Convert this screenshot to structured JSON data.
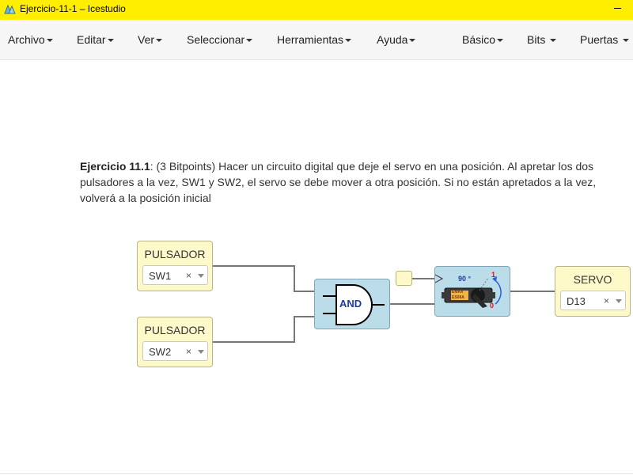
{
  "window": {
    "title": "Ejercicio-11-1 – Icestudio"
  },
  "menubar": {
    "left": [
      {
        "label": "Archivo"
      },
      {
        "label": "Editar"
      },
      {
        "label": "Ver"
      },
      {
        "label": "Seleccionar"
      },
      {
        "label": "Herramientas"
      },
      {
        "label": "Ayuda"
      }
    ],
    "right": [
      {
        "label": "Básico"
      },
      {
        "label": "Bits"
      },
      {
        "label": "Puertas"
      }
    ]
  },
  "description": {
    "heading": "Ejercicio 11.1",
    "body": ": (3 Bitpoints) Hacer un circuito digital que deje el servo en una posición. Al apretar los dos pulsadores a la vez, SW1 y SW2, el servo se debe mover a otra posición. Si no están apretados a la vez, volverá a la posición inicial"
  },
  "blocks": {
    "pulsador1": {
      "title": "PULSADOR",
      "value": "SW1",
      "clear": "×"
    },
    "pulsador2": {
      "title": "PULSADOR",
      "value": "SW2",
      "clear": "×"
    },
    "and_gate": {
      "label": "AND"
    },
    "servo_block": {
      "label_90": "90 °",
      "label_1": "1",
      "label_0": "0",
      "brand_top": "EMAX",
      "brand_bottom": "ES08A"
    },
    "servo_output": {
      "title": "SERVO",
      "value": "D13",
      "clear": "×"
    }
  },
  "colors": {
    "titlebar": "#ffee00",
    "io_block": "#fdf9c9",
    "gate_block": "#bbdde9",
    "wire": "#777777"
  }
}
